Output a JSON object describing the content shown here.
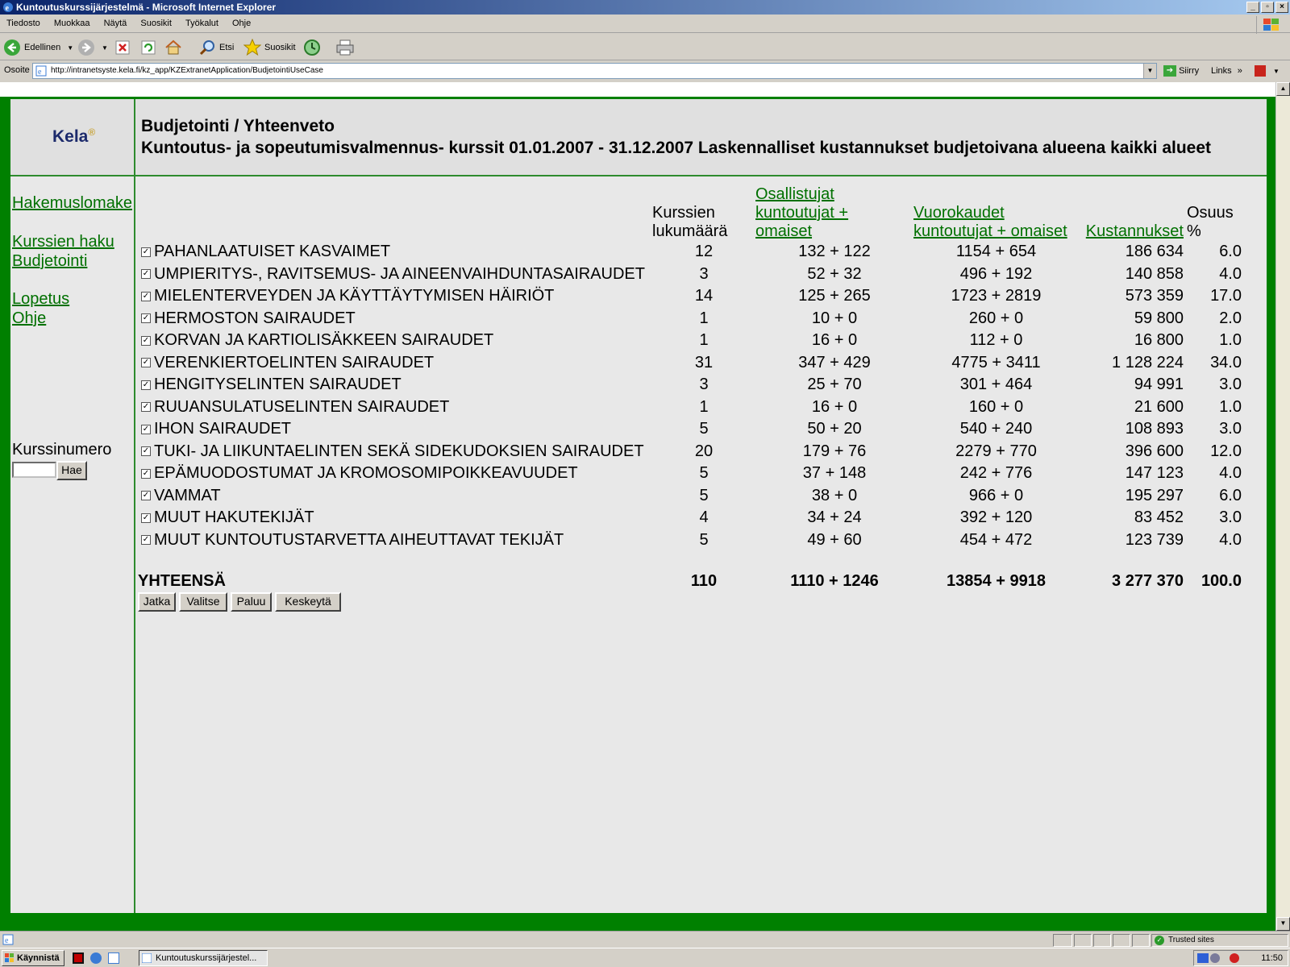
{
  "window": {
    "title": "Kuntoutuskurssijärjestelmä - Microsoft Internet Explorer"
  },
  "menu": [
    "Tiedosto",
    "Muokkaa",
    "Näytä",
    "Suosikit",
    "Työkalut",
    "Ohje"
  ],
  "toolbar": {
    "back_label": "Edellinen",
    "search_label": "Etsi",
    "favorites_label": "Suosikit"
  },
  "address": {
    "label": "Osoite",
    "url": "http://intranetsyste.kela.fi/kz_app/KZExtranetApplication/BudjetointiUseCase",
    "go_label": "Siirry",
    "links_label": "Links"
  },
  "logo": {
    "text": "Kela"
  },
  "header": {
    "title": "Budjetointi / Yhteenveto",
    "subtitle": "Kuntoutus- ja sopeutumisvalmennus- kurssit 01.01.2007 - 31.12.2007 Laskennalliset kustannukset budjetoivana alueena kaikki alueet"
  },
  "sidebar": {
    "links": [
      "Hakemuslomake",
      "Kurssien haku",
      "Budjetointi",
      "Lopetus",
      "Ohje"
    ],
    "course_number_label": "Kurssinumero",
    "search_button": "Hae"
  },
  "table": {
    "headers": {
      "count_line1": "Kurssien",
      "count_line2": "lukumäärä",
      "participants_line1": "Osallistujat",
      "participants_line2": "kuntoutujat +",
      "participants_line3": "omaiset",
      "days_line1": "Vuorokaudet",
      "days_line2": "kuntoutujat + omaiset",
      "costs": "Kustannukset",
      "share_line1": "Osuus",
      "share_line2": "%"
    },
    "rows": [
      {
        "name": "PAHANLAATUISET KASVAIMET",
        "count": "12",
        "participants": "132 + 122",
        "days": "1154 + 654",
        "costs": "186 634",
        "share": "6.0"
      },
      {
        "name": "UMPIERITYS-, RAVITSEMUS- JA AINEENVAIHDUNTASAIRAUDET",
        "count": "3",
        "participants": "52 + 32",
        "days": "496 + 192",
        "costs": "140 858",
        "share": "4.0"
      },
      {
        "name": "MIELENTERVEYDEN JA KÄYTTÄYTYMISEN HÄIRIÖT",
        "count": "14",
        "participants": "125 + 265",
        "days": "1723 + 2819",
        "costs": "573 359",
        "share": "17.0"
      },
      {
        "name": "HERMOSTON SAIRAUDET",
        "count": "1",
        "participants": "10 + 0",
        "days": "260 + 0",
        "costs": "59 800",
        "share": "2.0"
      },
      {
        "name": "KORVAN JA KARTIOLISÄKKEEN SAIRAUDET",
        "count": "1",
        "participants": "16 + 0",
        "days": "112 + 0",
        "costs": "16 800",
        "share": "1.0"
      },
      {
        "name": "VERENKIERTOELINTEN SAIRAUDET",
        "count": "31",
        "participants": "347 + 429",
        "days": "4775 + 3411",
        "costs": "1 128 224",
        "share": "34.0"
      },
      {
        "name": "HENGITYSELINTEN SAIRAUDET",
        "count": "3",
        "participants": "25 + 70",
        "days": "301 + 464",
        "costs": "94 991",
        "share": "3.0"
      },
      {
        "name": "RUUANSULATUSELINTEN SAIRAUDET",
        "count": "1",
        "participants": "16 + 0",
        "days": "160 + 0",
        "costs": "21 600",
        "share": "1.0"
      },
      {
        "name": "IHON SAIRAUDET",
        "count": "5",
        "participants": "50 + 20",
        "days": "540 + 240",
        "costs": "108 893",
        "share": "3.0"
      },
      {
        "name": "TUKI- JA LIIKUNTAELINTEN SEKÄ SIDEKUDOKSIEN SAIRAUDET",
        "count": "20",
        "participants": "179 + 76",
        "days": "2279 + 770",
        "costs": "396 600",
        "share": "12.0"
      },
      {
        "name": "EPÄMUODOSTUMAT JA KROMOSOMIPOIKKEAVUUDET",
        "count": "5",
        "participants": "37 + 148",
        "days": "242 + 776",
        "costs": "147 123",
        "share": "4.0"
      },
      {
        "name": "VAMMAT",
        "count": "5",
        "participants": "38 + 0",
        "days": "966 + 0",
        "costs": "195 297",
        "share": "6.0"
      },
      {
        "name": "MUUT HAKUTEKIJÄT",
        "count": "4",
        "participants": "34 + 24",
        "days": "392 + 120",
        "costs": "83 452",
        "share": "3.0"
      },
      {
        "name": "MUUT KUNTOUTUSTARVETTA AIHEUTTAVAT TEKIJÄT",
        "count": "5",
        "participants": "49 + 60",
        "days": "454 + 472",
        "costs": "123 739",
        "share": "4.0"
      }
    ],
    "total": {
      "label": "YHTEENSÄ",
      "count": "110",
      "participants": "1110 + 1246",
      "days": "13854 + 9918",
      "costs": "3 277 370",
      "share": "100.0"
    }
  },
  "actions": [
    "Jatka",
    "Valitse",
    "Paluu",
    "Keskeytä"
  ],
  "statusbar": {
    "zone": "Trusted sites"
  },
  "taskbar": {
    "start_label": "Käynnistä",
    "task_label": "Kuntoutuskurssijärjestel...",
    "clock": "11:50"
  },
  "colors": {
    "page_frame": "#008000",
    "link": "#007000",
    "title_bar_start": "#0a246a"
  }
}
